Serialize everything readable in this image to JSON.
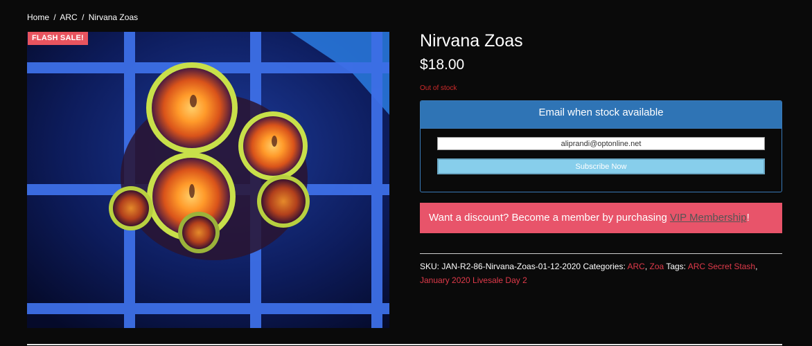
{
  "breadcrumb": {
    "home": "Home",
    "sep1": "/",
    "category": "ARC",
    "sep2": "/",
    "current": "Nirvana Zoas"
  },
  "badge": {
    "label": "FLASH SALE!"
  },
  "product": {
    "title": "Nirvana Zoas",
    "price": "$18.00",
    "stock_status": "Out of stock"
  },
  "notify": {
    "header": "Email when stock available",
    "email_value": "aliprandi@optonline.net",
    "subscribe_label": "Subscribe Now"
  },
  "discount": {
    "prefix": "Want a discount? Become a member by purchasing ",
    "link_label": "VIP Membership",
    "suffix": "!"
  },
  "meta": {
    "sku_label": "SKU:",
    "sku_value": "JAN-R2-86-Nirvana-Zoas-01-12-2020",
    "categories_label": "Categories:",
    "categories": [
      "ARC",
      "Zoa"
    ],
    "tags_label": "Tags:",
    "tags": [
      "ARC Secret Stash",
      "January 2020 Livesale Day 2"
    ]
  },
  "colors": {
    "accent_red": "#e8545f",
    "notify_blue": "#2f74b5",
    "subscribe_blue": "#87ceeb",
    "link_red": "#e03a4a",
    "out_of_stock": "#d12b2b"
  }
}
